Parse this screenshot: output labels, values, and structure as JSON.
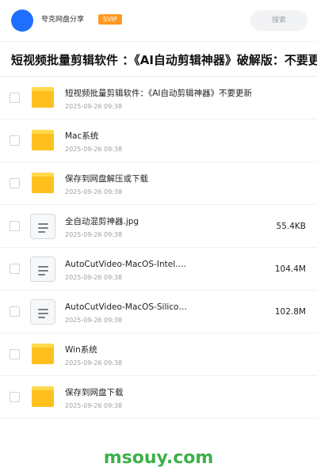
{
  "header": {
    "app_name": "夸克网盘分享",
    "badge": "SVIP",
    "search_placeholder": "搜索"
  },
  "title": "短视频批量剪辑软件 ：《AI自动剪辑神器》破解版：不要更新",
  "files": [
    {
      "type": "folder",
      "name": "短视频批量剪辑软件：《AI自动剪辑神器》不要更新",
      "date": "2025-09-26 09:38",
      "size": ""
    },
    {
      "type": "folder",
      "name": "Mac系统",
      "date": "2025-09-26 09:38",
      "size": ""
    },
    {
      "type": "folder",
      "name": "保存到网盘解压或下载",
      "date": "2025-09-26 09:38",
      "size": ""
    },
    {
      "type": "file",
      "name": "全自动混剪神器.jpg",
      "date": "2025-09-26 09:38",
      "size": "55.4KB"
    },
    {
      "type": "file",
      "name": "AutoCutVideo-MacOS-Intel.…",
      "date": "2025-09-26 09:38",
      "size": "104.4M"
    },
    {
      "type": "file",
      "name": "AutoCutVideo-MacOS-Silico…",
      "date": "2025-09-26 09:38",
      "size": "102.8M"
    },
    {
      "type": "folder",
      "name": "Win系统",
      "date": "2025-09-26 09:38",
      "size": ""
    },
    {
      "type": "folder",
      "name": "保存到网盘下载",
      "date": "2025-09-26 09:38",
      "size": ""
    }
  ],
  "watermark": "msouy.com",
  "colors": {
    "avatar": "#1f6fff",
    "badge": "#ff9a1f",
    "folder": "#ffc01e",
    "watermark": "#3eb04a"
  }
}
